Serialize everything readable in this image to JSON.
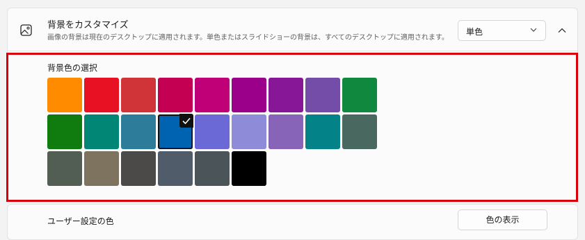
{
  "header": {
    "icon": "picture-icon",
    "title": "背景をカスタマイズ",
    "description": "画像の背景は現在のデスクトップに適用されます。単色またはスライドショーの背景は、すべてのデスクトップに適用されます。",
    "dropdown_value": "単色",
    "collapse_icon": "chevron-up-icon"
  },
  "background_colors": {
    "label": "背景色の選択",
    "selected_index": 12,
    "colors": [
      "#ff8c00",
      "#e81123",
      "#d13438",
      "#c30052",
      "#bf0077",
      "#9a0089",
      "#881798",
      "#744da9",
      "#10893e",
      "#107c10",
      "#018574",
      "#2d7d9a",
      "#0063b1",
      "#6b69d6",
      "#8e8cd8",
      "#8764b8",
      "#038387",
      "#486860",
      "#525e54",
      "#7e735f",
      "#4c4a48",
      "#515c6b",
      "#4a5459",
      "#000000"
    ]
  },
  "custom_color": {
    "label": "ユーザー設定の色",
    "button_label": "色の表示"
  },
  "colors": {
    "highlight": "#d9000d"
  }
}
